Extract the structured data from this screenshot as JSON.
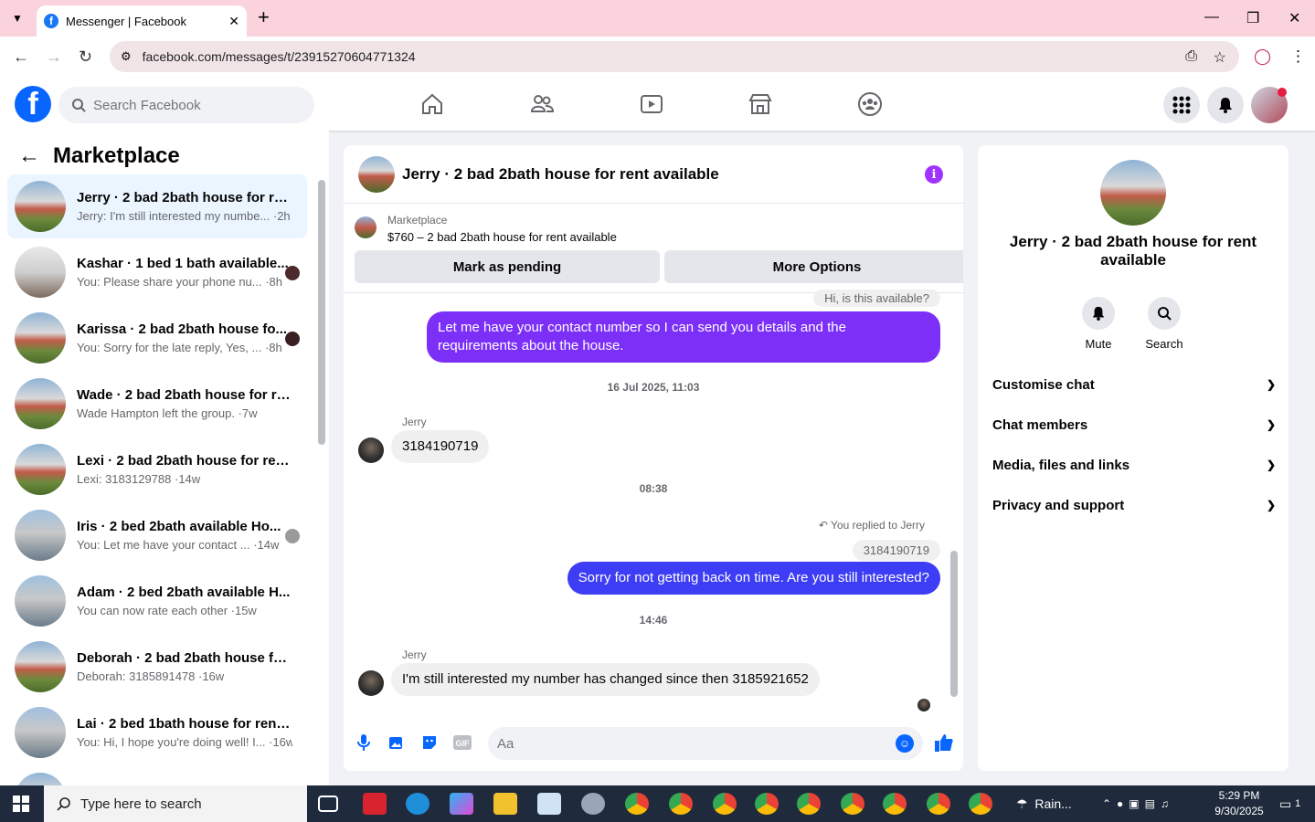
{
  "browser": {
    "tab_title": "Messenger | Facebook",
    "url": "facebook.com/messages/t/23915270604771324"
  },
  "fb_header": {
    "search_placeholder": "Search Facebook"
  },
  "sidebar": {
    "title": "Marketplace",
    "conversations": [
      {
        "name": "Jerry · 2 bad 2bath house for re...",
        "preview": "Jerry: I'm still interested my numbe... ·2h"
      },
      {
        "name": "Kashar · 1 bed 1 bath available...",
        "preview": "You: Please share your phone nu... ·8h"
      },
      {
        "name": "Karissa · 2 bad 2bath house fo...",
        "preview": "You: Sorry for the late reply, Yes, ... ·8h"
      },
      {
        "name": "Wade · 2 bad 2bath house for re...",
        "preview": "Wade Hampton left the group. ·7w"
      },
      {
        "name": "Lexi · 2 bad 2bath house for rent...",
        "preview": "Lexi: 3183129788 ·14w"
      },
      {
        "name": "Iris · 2 bed 2bath available Ho...",
        "preview": "You: Let me have your contact ... ·14w"
      },
      {
        "name": "Adam · 2 bed 2bath available H...",
        "preview": "You can now rate each other ·15w"
      },
      {
        "name": "Deborah · 2 bad 2bath house fo...",
        "preview": "Deborah: 3185891478 ·16w"
      },
      {
        "name": "Lai · 2 bed 1bath house for rent ...",
        "preview": "You: Hi, I hope you're doing well! I... ·16w"
      }
    ]
  },
  "chat": {
    "title": "Jerry · 2 bad 2bath house for rent available",
    "marketplace_label": "Marketplace",
    "listing": "$760 – 2 bad 2bath house for rent available",
    "btn_pending": "Mark as pending",
    "btn_more": "More Options",
    "msg_top_quote": "Hi, is this available?",
    "msg_out_1": "Let me have your contact number so I can send you details and the requirements about the house.",
    "ts_1": "16 Jul 2025, 11:03",
    "sender_1": "Jerry",
    "msg_in_1": "3184190719",
    "ts_2": "08:38",
    "replied_label": "You replied to Jerry",
    "quoted": "3184190719",
    "msg_out_2": "Sorry for not getting back on time. Are you still interested?",
    "ts_3": "14:46",
    "sender_2": "Jerry",
    "msg_in_2": "I'm still interested my number has changed since then 3185921652",
    "composer_placeholder": "Aa"
  },
  "info_panel": {
    "name": "Jerry · 2 bad 2bath house for rent available",
    "mute": "Mute",
    "search": "Search",
    "sections": [
      "Customise chat",
      "Chat members",
      "Media, files and links",
      "Privacy and support"
    ]
  },
  "taskbar": {
    "search_placeholder": "Type here to search",
    "weather": "Rain...",
    "time": "5:29 PM",
    "date": "9/30/2025",
    "notif_count": "1"
  }
}
